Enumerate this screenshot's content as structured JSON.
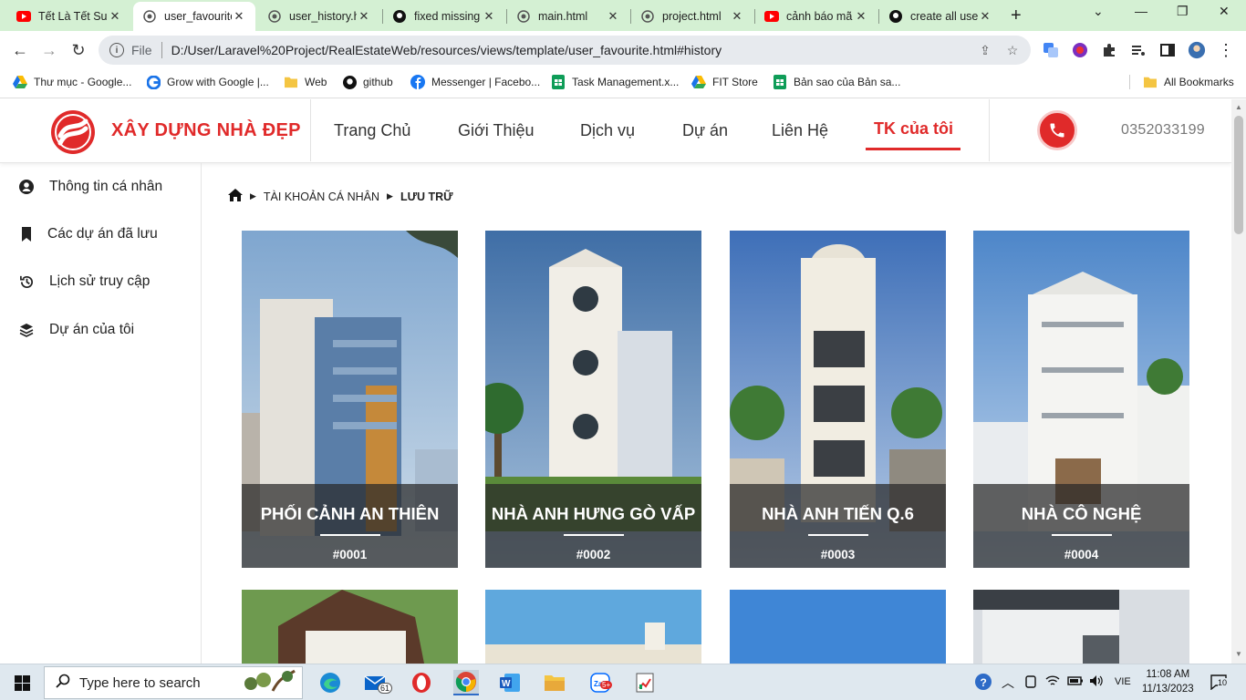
{
  "browser": {
    "tabs": [
      {
        "title": "Tết Là Tết Sum",
        "icon": "youtube-icon",
        "active": false
      },
      {
        "title": "user_favourite",
        "icon": "globe-icon",
        "active": true
      },
      {
        "title": "user_history.h",
        "icon": "globe-icon",
        "active": false
      },
      {
        "title": "fixed missing",
        "icon": "github-icon",
        "active": false
      },
      {
        "title": "main.html",
        "icon": "globe-icon",
        "active": false
      },
      {
        "title": "project.html",
        "icon": "globe-icon",
        "active": false
      },
      {
        "title": "cảnh báo mã",
        "icon": "youtube-icon",
        "active": false
      },
      {
        "title": "create all use",
        "icon": "github-icon",
        "active": false
      }
    ],
    "address": {
      "scheme": "File",
      "url": "D:/User/Laravel%20Project/RealEstateWeb/resources/views/template/user_favourite.html#history"
    },
    "bookmarks": [
      {
        "label": "Thư mục - Google...",
        "icon": "google-drive-icon"
      },
      {
        "label": "Grow with Google |...",
        "icon": "google-icon"
      },
      {
        "label": "Web",
        "icon": "folder-icon"
      },
      {
        "label": "github",
        "icon": "github-icon"
      },
      {
        "label": "Messenger | Facebo...",
        "icon": "facebook-icon"
      },
      {
        "label": "Task Management.x...",
        "icon": "sheets-icon"
      },
      {
        "label": "FIT Store",
        "icon": "google-drive-icon"
      },
      {
        "label": "Bản sao của Bản sa...",
        "icon": "sheets-icon"
      }
    ],
    "all_bookmarks": "All Bookmarks"
  },
  "site": {
    "brand": "XÂY DỰNG NHÀ ĐẸP",
    "nav": [
      "Trang Chủ",
      "Giới Thiệu",
      "Dịch vụ",
      "Dự án",
      "Liên Hệ",
      "TK của tôi"
    ],
    "active_nav": "TK của tôi",
    "phone": "0352033199",
    "accent_color": "#e02a2a",
    "sidebar": [
      {
        "label": "Thông tin cá nhân",
        "icon": "user-circle-icon"
      },
      {
        "label": "Các dự án đã lưu",
        "icon": "bookmark-icon"
      },
      {
        "label": "Lịch sử truy cập",
        "icon": "history-icon"
      },
      {
        "label": "Dự án của tôi",
        "icon": "layers-icon"
      }
    ],
    "breadcrumb": {
      "home_icon": "home-icon",
      "items": [
        "TÀI KHOẢN CÁ NHÂN",
        "LƯU TRỮ"
      ]
    },
    "projects": [
      {
        "name": "PHỐI CẢNH AN THIÊN",
        "code": "#0001"
      },
      {
        "name": "NHÀ ANH HƯNG GÒ VẤP",
        "code": "#0002"
      },
      {
        "name": "NHÀ ANH TIẾN Q.6",
        "code": "#0003"
      },
      {
        "name": "NHÀ CÔ NGHỆ",
        "code": "#0004"
      }
    ]
  },
  "taskbar": {
    "search_placeholder": "Type here to search",
    "mail_badge": "61",
    "zalo_badge": "5+",
    "language": "VIE",
    "time": "11:08 AM",
    "date": "11/13/2023",
    "notification_count": "10"
  }
}
